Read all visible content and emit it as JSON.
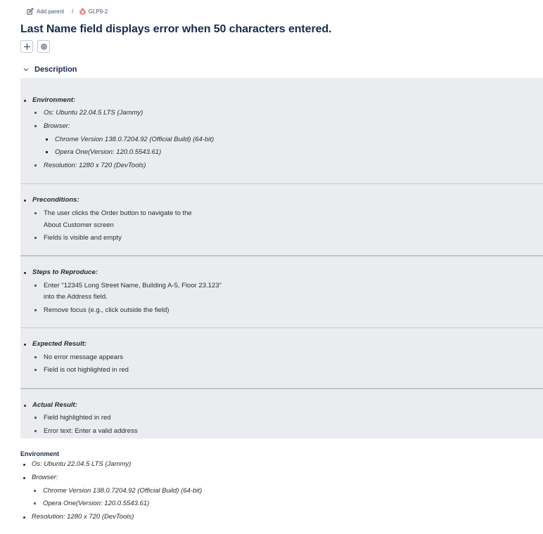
{
  "breadcrumb": {
    "add_parent_label": "Add parent",
    "separator": "/",
    "issue_key": "GLP9-2",
    "issue_icon": "bug-icon"
  },
  "title": "Last Name field displays error when 50 characters entered.",
  "actions": {
    "add_icon": "plus-icon",
    "link_icon": "gear-icon"
  },
  "description": {
    "label": "Description",
    "toggle_icon": "chevron-down-icon",
    "sections": {
      "environment": {
        "heading": "Environment:",
        "os": "Os: Ubuntu 22.04.5 LTS (Jammy)",
        "browser": "Browser:",
        "chrome": "Chrome Version 138.0.7204.92 (Official Build) (64-bit)",
        "opera": "Opera One(Version: 120.0.5543.61)",
        "resolution": "Resolution: 1280 x 720 (DevTools)"
      },
      "preconditions": {
        "heading": "Preconditions:",
        "item1_line1": "The user clicks the Order button to navigate to the",
        "item1_line2": "About Customer screen",
        "item2": "Fields is visible and empty"
      },
      "steps": {
        "heading": "Steps to Reproduce:",
        "item1_line1": "Enter \"12345 Long Street Name, Building A-5, Floor 23.123\"",
        "item1_line2": "into the Address field.",
        "item2": "Remove focus (e.g., click outside the field)"
      },
      "expected": {
        "heading": "Expected Result:",
        "item1": "No error message appears",
        "item2": "Field is not highlighted in red"
      },
      "actual": {
        "heading": "Actual Result:",
        "item1": "Field highlighted in red",
        "item2": "Error text: Enter a valid address"
      }
    }
  },
  "environment_block": {
    "title": "Environment",
    "os": "Os: Ubuntu 22.04.5 LTS (Jammy)",
    "browser": "Browser:",
    "chrome": "Chrome Version 138.0.7204.92 (Official Build) (64-bit)",
    "opera": "Opera One(Version: 120.0.5543.61)",
    "resolution": "Resolution: 1280 x 720 (DevTools)"
  },
  "colors": {
    "panel_bg": "#ebecf0",
    "bug_red": "#e2483d",
    "text": "#172b4d"
  }
}
